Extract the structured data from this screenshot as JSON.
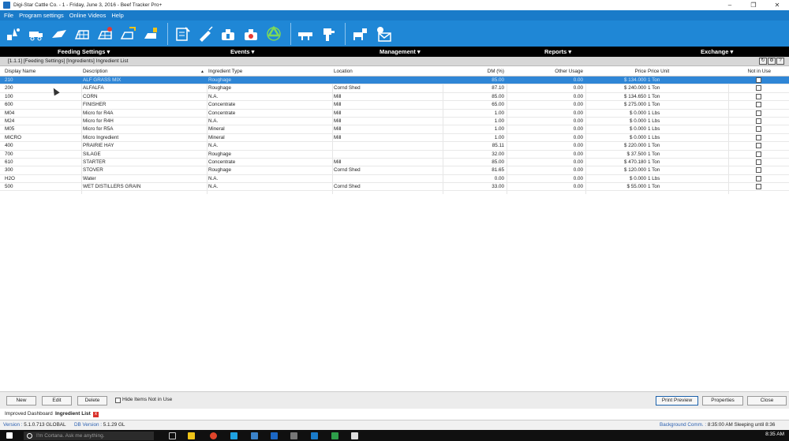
{
  "window": {
    "title": "Digi-Star Cattle Co. - 1 - Friday, June 3, 2016 - Beef Tracker Pro+",
    "controls": {
      "minimize": "–",
      "restore": "❐",
      "close": "✕"
    }
  },
  "menu": [
    "File",
    "Program settings",
    "Online Videos",
    "Help"
  ],
  "toolbar_icons": [
    "feeding-icon",
    "truck-icon",
    "ration-icon",
    "pen-icon",
    "pen-alert-icon",
    "pen-transfer-icon",
    "pen-feed-icon",
    "notes-icon",
    "syringe-icon",
    "medicine-icon",
    "medicine-alert-icon",
    "recycle-icon",
    "scale-truck-icon",
    "loader-icon",
    "chute-icon",
    "email-icon"
  ],
  "nav": [
    "Feeding Settings ▾",
    "Events ▾",
    "Management ▾",
    "Reports ▾",
    "Exchange ▾"
  ],
  "breadcrumb": "[1.1.1] [Feeding Settings] [Ingredients] Ingredient List",
  "breadcrumb_icons": [
    "refresh-icon",
    "settings-icon",
    "help-icon"
  ],
  "table": {
    "headers": {
      "display_name": "Display Name",
      "description": "Description",
      "ingredient_type": "Ingredient Type",
      "location": "Location",
      "dm": "DM (%)",
      "other_usage": "Other Usage",
      "price": "Price",
      "price_unit": "Price Unit",
      "not_in_use": "Not in Use"
    },
    "rows": [
      {
        "name": "210",
        "desc": "ALF GRASS MIX",
        "type": "Roughage",
        "loc": "",
        "dm": "85.00",
        "other": "0.00",
        "price": "$ 134.000",
        "unit": "1 Ton"
      },
      {
        "name": "200",
        "desc": "ALFALFA",
        "type": "Roughage",
        "loc": "Cornd Shed",
        "dm": "87.10",
        "other": "0.00",
        "price": "$ 240.000",
        "unit": "1 Ton"
      },
      {
        "name": "100",
        "desc": "CORN",
        "type": "N.A.",
        "loc": "Mill",
        "dm": "85.00",
        "other": "0.00",
        "price": "$ 134.650",
        "unit": "1 Ton"
      },
      {
        "name": "600",
        "desc": "FINISHER",
        "type": "Concentrate",
        "loc": "Mill",
        "dm": "65.00",
        "other": "0.00",
        "price": "$ 275.000",
        "unit": "1 Ton"
      },
      {
        "name": "M04",
        "desc": "Micro for R4A",
        "type": "Concentrate",
        "loc": "Mill",
        "dm": "1.00",
        "other": "0.00",
        "price": "$ 0.000",
        "unit": "1 Lbs"
      },
      {
        "name": "M24",
        "desc": "Micro for R4H",
        "type": "N.A.",
        "loc": "Mill",
        "dm": "1.00",
        "other": "0.00",
        "price": "$ 0.000",
        "unit": "1 Lbs"
      },
      {
        "name": "M05",
        "desc": "Micro for R5A",
        "type": "Mineral",
        "loc": "Mill",
        "dm": "1.00",
        "other": "0.00",
        "price": "$ 0.000",
        "unit": "1 Lbs"
      },
      {
        "name": "MICRO",
        "desc": "Micro Ingredient",
        "type": "Mineral",
        "loc": "Mill",
        "dm": "1.00",
        "other": "0.00",
        "price": "$ 0.000",
        "unit": "1 Lbs"
      },
      {
        "name": "400",
        "desc": "PRAIRIE HAY",
        "type": "N.A.",
        "loc": "",
        "dm": "85.11",
        "other": "0.00",
        "price": "$ 220.000",
        "unit": "1 Ton"
      },
      {
        "name": "700",
        "desc": "SILAGE",
        "type": "Roughage",
        "loc": "",
        "dm": "32.00",
        "other": "0.00",
        "price": "$ 37.500",
        "unit": "1 Ton"
      },
      {
        "name": "610",
        "desc": "STARTER",
        "type": "Concentrate",
        "loc": "Mill",
        "dm": "85.00",
        "other": "0.00",
        "price": "$ 470.180",
        "unit": "1 Ton"
      },
      {
        "name": "300",
        "desc": "STOVER",
        "type": "Roughage",
        "loc": "Cornd Shed",
        "dm": "81.65",
        "other": "0.00",
        "price": "$ 120.000",
        "unit": "1 Ton"
      },
      {
        "name": "H2O",
        "desc": "Water",
        "type": "N.A.",
        "loc": "",
        "dm": "0.00",
        "other": "0.00",
        "price": "$ 0.000",
        "unit": "1 Lbs"
      },
      {
        "name": "500",
        "desc": "WET DISTILLERS GRAIN",
        "type": "N.A.",
        "loc": "Cornd Shed",
        "dm": "33.00",
        "other": "0.00",
        "price": "$ 55.000",
        "unit": "1 Ton"
      }
    ]
  },
  "buttons": {
    "new": "New",
    "edit": "Edit",
    "delete": "Delete",
    "hide_label": "Hide Items Not in Use",
    "print_preview": "Print Preview",
    "properties": "Properties",
    "close": "Close"
  },
  "doc_tabs": {
    "tab1": "Improved Dashboard",
    "tab2": "Ingredient List",
    "close_glyph": "x"
  },
  "status": {
    "version_label": "Version :",
    "version_value": "5.1.0.713 GLOBAL",
    "db_label": "DB Version :",
    "db_value": "5.1.29 GL",
    "bg_label": "Background Comm. :",
    "bg_value": "8:35:00 AM Sleeping until 8:36"
  },
  "taskbar": {
    "search_placeholder": "I'm Cortana. Ask me anything.",
    "time": "8:35 AM"
  },
  "colors": {
    "menu_blue": "#1a7bc9",
    "toolbar_blue": "#1f87d6",
    "selection": "#2f86d6",
    "nav_black": "#000000"
  }
}
